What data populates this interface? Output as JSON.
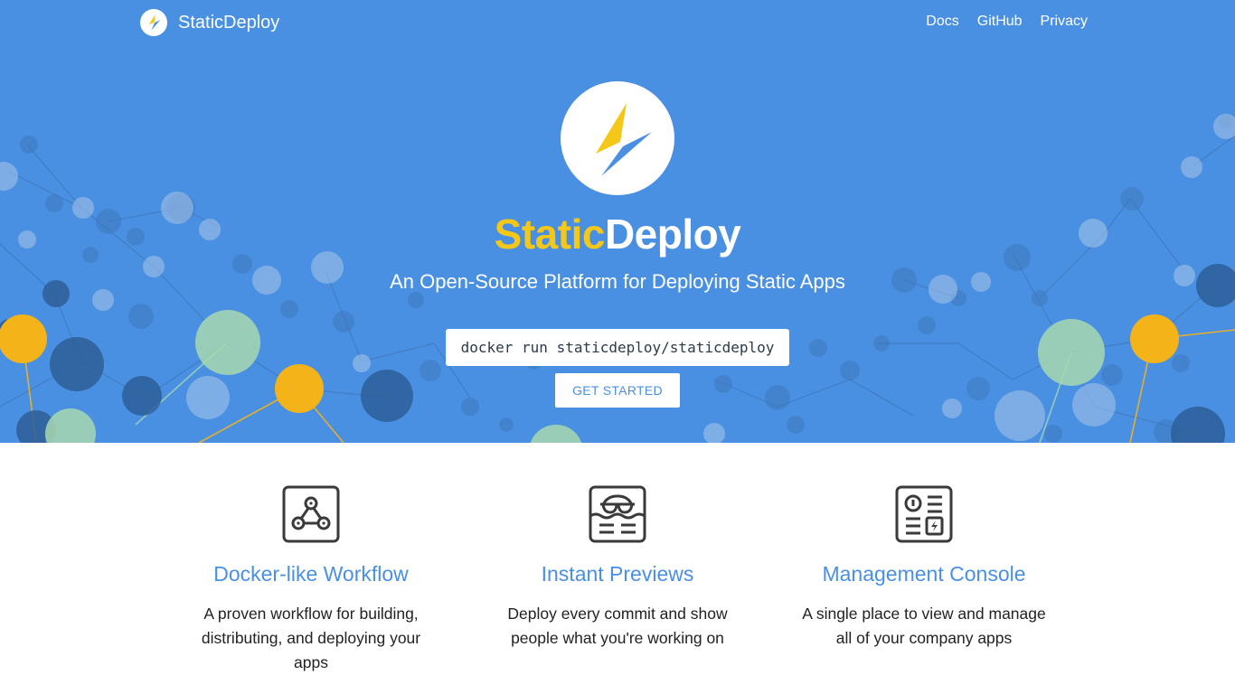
{
  "brand": {
    "name": "StaticDeploy"
  },
  "nav": {
    "links": [
      {
        "label": "Docs"
      },
      {
        "label": "GitHub"
      },
      {
        "label": "Privacy"
      }
    ]
  },
  "hero": {
    "title_part1": "Static",
    "title_part2": "Deploy",
    "subtitle": "An Open-Source Platform for Deploying Static Apps",
    "command": "docker run staticdeploy/staticdeploy",
    "cta_label": "GET STARTED"
  },
  "features": [
    {
      "icon": "network-nodes-icon",
      "title": "Docker-like Workflow",
      "description": "A proven workflow for building, distributing, and deploying your apps"
    },
    {
      "icon": "glasses-preview-icon",
      "title": "Instant Previews",
      "description": "Deploy every commit and show people what you're working on"
    },
    {
      "icon": "console-dashboard-icon",
      "title": "Management Console",
      "description": "A single place to view and manage all of your company apps"
    }
  ],
  "colors": {
    "primary": "#4a90e2",
    "accent_yellow": "#f5c718",
    "bolt_blue": "#4a90e2",
    "text_dark": "#222222"
  }
}
